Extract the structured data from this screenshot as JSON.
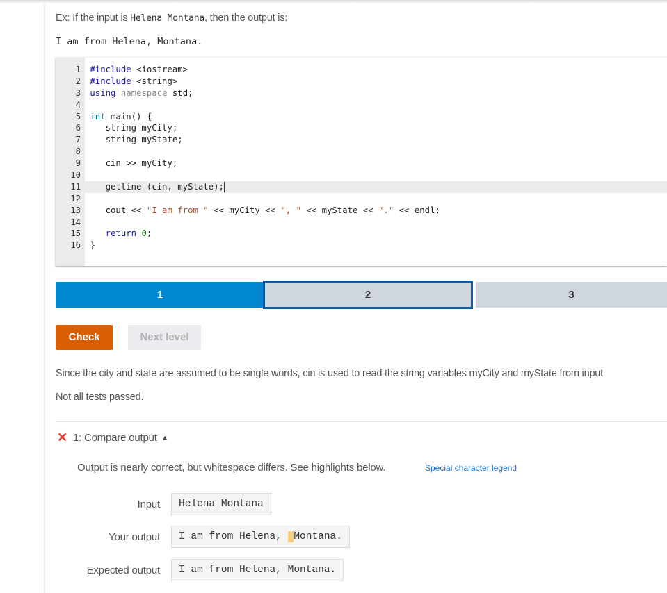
{
  "intro": {
    "prefix": "Ex: If the input is ",
    "input_code": "Helena Montana",
    "suffix": ", then the output is:",
    "example_output": "I am from Helena, Montana."
  },
  "editor": {
    "active_line": 11,
    "lines": [
      {
        "n": "1",
        "code": "#include <iostream>"
      },
      {
        "n": "2",
        "code": "#include <string>"
      },
      {
        "n": "3",
        "code": "using namespace std;"
      },
      {
        "n": "4",
        "code": ""
      },
      {
        "n": "5",
        "code": "int main() {"
      },
      {
        "n": "6",
        "code": "   string myCity;"
      },
      {
        "n": "7",
        "code": "   string myState;"
      },
      {
        "n": "8",
        "code": ""
      },
      {
        "n": "9",
        "code": "   cin >> myCity;"
      },
      {
        "n": "10",
        "code": ""
      },
      {
        "n": "11",
        "code": "   getline (cin, myState);"
      },
      {
        "n": "12",
        "code": ""
      },
      {
        "n": "13",
        "code": "   cout << \"I am from \" << myCity << \", \" << myState << \".\" << endl;"
      },
      {
        "n": "14",
        "code": ""
      },
      {
        "n": "15",
        "code": "   return 0;"
      },
      {
        "n": "16",
        "code": "}"
      }
    ]
  },
  "steps": [
    {
      "label": "1",
      "state": "completed"
    },
    {
      "label": "2",
      "state": "current"
    },
    {
      "label": "3",
      "state": "pending"
    }
  ],
  "buttons": {
    "check": "Check",
    "next_level": "Next level"
  },
  "colors": {
    "step_done": "#0288d1",
    "step_current_border": "#0a5aa0",
    "check_button": "#d95f02",
    "fail_icon": "#e53935",
    "whitespace_highlight": "#f5cf7a"
  },
  "explanation": "Since the city and state are assumed to be single words, cin is used to read the string variables myCity and myState from input",
  "status": "Not all tests passed.",
  "test": {
    "icon": "x-fail-icon",
    "title": "1: Compare output",
    "message": "Output is nearly correct, but whitespace differs. See highlights below.",
    "legend_link": "Special character legend",
    "input_label": "Input",
    "input_value": "Helena Montana",
    "your_output_label": "Your output",
    "your_output_before": "I am from Helena, ",
    "your_output_highlight": " ",
    "your_output_after": "Montana.",
    "expected_label": "Expected output",
    "expected_value": "I am from Helena, Montana."
  }
}
